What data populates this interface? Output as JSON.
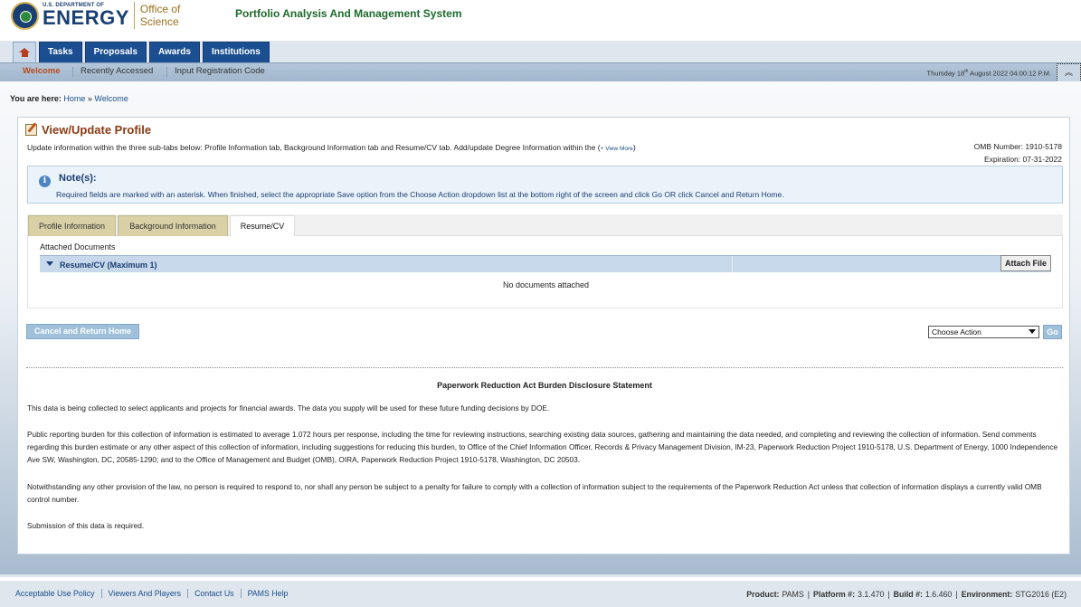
{
  "header": {
    "doe_small": "U.S. DEPARTMENT OF",
    "doe_big": "ENERGY",
    "office_line1": "Office of",
    "office_line2": "Science",
    "app_title": "Portfolio Analysis And Management System"
  },
  "main_tabs": [
    "Tasks",
    "Proposals",
    "Awards",
    "Institutions"
  ],
  "subnav": {
    "welcome": "Welcome",
    "recently_accessed": "Recently Accessed",
    "input_registration": "Input Registration Code",
    "date_pre": "Thursday 18",
    "date_sup": "th",
    "date_post": " August 2022 04:00:12 P.M."
  },
  "breadcrumb": {
    "label": "You are here:",
    "home": "Home",
    "sep": " » ",
    "current": "Welcome"
  },
  "page": {
    "title": "View/Update Profile",
    "description": "Update information within the three sub-tabs below: Profile Information tab, Background Information tab and Resume/CV tab. Add/update Degree Information within the (",
    "view_more": "+ View More",
    "description_end": ")",
    "omb_number": "OMB Number: 1910-5178",
    "expiration": "Expiration: 07-31-2022"
  },
  "notes": {
    "title": "Note(s):",
    "text": "Required fields are marked with an asterisk. When finished, select the appropriate Save option from the Choose Action dropdown list at the bottom right of the screen and click Go OR click Cancel and Return Home."
  },
  "sub_tabs": {
    "profile": "Profile Information",
    "background": "Background Information",
    "resume": "Resume/CV"
  },
  "documents": {
    "label": "Attached Documents",
    "section": "Resume/CV (Maximum 1)",
    "attach_button": "Attach File",
    "empty": "No documents attached"
  },
  "actions": {
    "cancel": "Cancel and Return Home",
    "select_value": "Choose Action",
    "go": "Go"
  },
  "prad": {
    "title": "Paperwork Reduction Act Burden Disclosure Statement",
    "p1": "This data is being collected to select applicants and projects for financial awards. The data you supply will be used for these future funding decisions by DOE.",
    "p2": "Public reporting burden for this collection of information is estimated to average 1.072 hours per response, including the time for reviewing instructions, searching existing data sources, gathering and maintaining the data needed, and completing and reviewing the collection of information. Send comments regarding this burden estimate or any other aspect of this collection of information, including suggestions for reducing this burden, to Office of the Chief Information Officer, Records & Privacy Management Division, IM-23, Paperwork Reduction Project 1910-5178, U.S. Department of Energy, 1000 Independence Ave SW, Washington, DC, 20585-1290; and to the Office of Management and Budget (OMB), OIRA, Paperwork Reduction Project 1910-5178, Washington, DC 20503.",
    "p3": "Notwithstanding any other provision of the law, no person is required to respond to, nor shall any person be subject to a penalty for failure to comply with a collection of information subject to the requirements of the Paperwork Reduction Act unless that collection of information displays a currently valid OMB control number.",
    "p4": "Submission of this data is required."
  },
  "footer": {
    "links": [
      "Acceptable Use Policy",
      "Viewers And Players",
      "Contact Us",
      "PAMS Help"
    ],
    "product_label": "Product:",
    "product": "PAMS",
    "platform_label": "Platform #:",
    "platform": "3.1.470",
    "build_label": "Build #:",
    "build": "1.6.460",
    "env_label": "Environment:",
    "env": "STG2016 (E2)"
  },
  "colors": {
    "tab_blue": "#1b4f91",
    "title_brown": "#8a3b12",
    "app_title_green": "#1d6a2c",
    "link_blue": "#1a4f8a"
  }
}
